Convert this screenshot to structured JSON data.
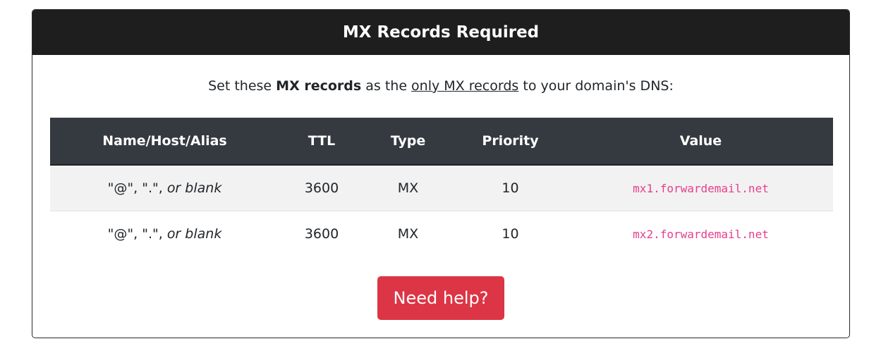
{
  "header": {
    "title": "MX Records Required"
  },
  "intro": {
    "prefix": "Set these ",
    "bold": "MX records",
    "middle": " as the ",
    "underline": "only MX records",
    "suffix": " to your domain's DNS:"
  },
  "table": {
    "columns": [
      "Name/Host/Alias",
      "TTL",
      "Type",
      "Priority",
      "Value"
    ],
    "rows": [
      {
        "name_quoted": "\"@\", \".\", ",
        "name_italic": "or blank",
        "ttl": "3600",
        "type": "MX",
        "priority": "10",
        "value": "mx1.forwardemail.net"
      },
      {
        "name_quoted": "\"@\", \".\", ",
        "name_italic": "or blank",
        "ttl": "3600",
        "type": "MX",
        "priority": "10",
        "value": "mx2.forwardemail.net"
      }
    ]
  },
  "actions": {
    "help_label": "Need help?"
  },
  "colors": {
    "header_bg": "#1e1e1e",
    "table_head_bg": "#343a40",
    "code_text": "#e83e8c",
    "button_bg": "#dc3545"
  }
}
